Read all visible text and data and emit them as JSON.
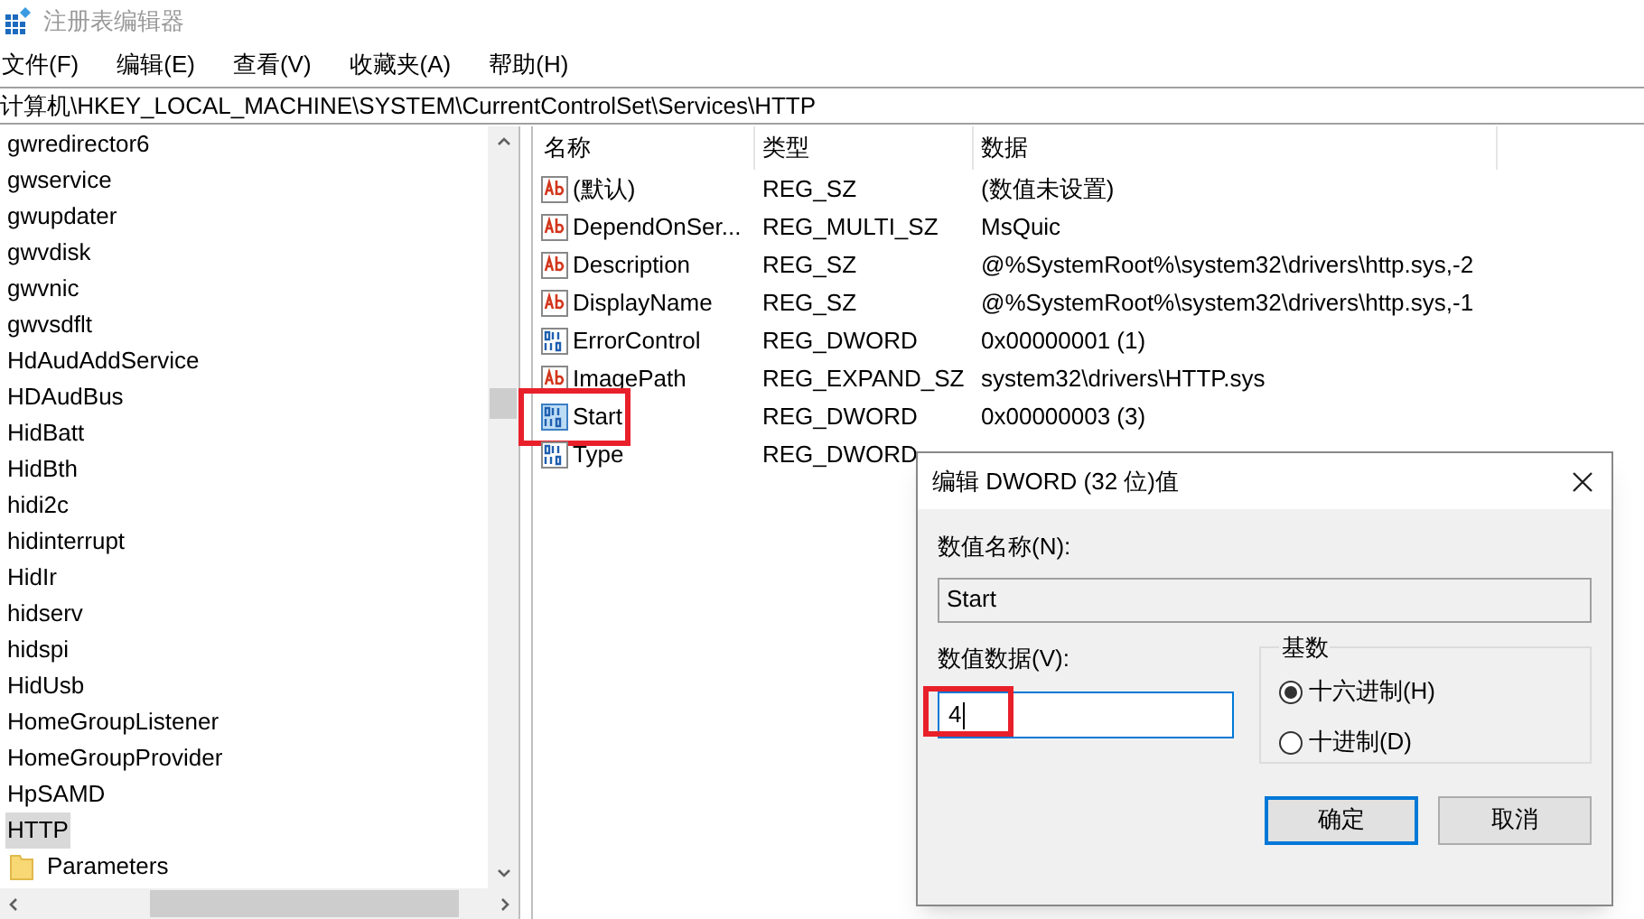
{
  "window": {
    "title": "注册表编辑器"
  },
  "menu": [
    "文件(F)",
    "编辑(E)",
    "查看(V)",
    "收藏夹(A)",
    "帮助(H)"
  ],
  "address": "计算机\\HKEY_LOCAL_MACHINE\\SYSTEM\\CurrentControlSet\\Services\\HTTP",
  "tree": [
    {
      "label": "gwredirector6",
      "selected": false
    },
    {
      "label": "gwservice",
      "selected": false
    },
    {
      "label": "gwupdater",
      "selected": false
    },
    {
      "label": "gwvdisk",
      "selected": false
    },
    {
      "label": "gwvnic",
      "selected": false
    },
    {
      "label": "gwvsdflt",
      "selected": false
    },
    {
      "label": "HdAudAddService",
      "selected": false
    },
    {
      "label": "HDAudBus",
      "selected": false
    },
    {
      "label": "HidBatt",
      "selected": false
    },
    {
      "label": "HidBth",
      "selected": false
    },
    {
      "label": "hidi2c",
      "selected": false
    },
    {
      "label": "hidinterrupt",
      "selected": false
    },
    {
      "label": "HidIr",
      "selected": false
    },
    {
      "label": "hidserv",
      "selected": false
    },
    {
      "label": "hidspi",
      "selected": false
    },
    {
      "label": "HidUsb",
      "selected": false
    },
    {
      "label": "HomeGroupListener",
      "selected": false
    },
    {
      "label": "HomeGroupProvider",
      "selected": false
    },
    {
      "label": "HpSAMD",
      "selected": false
    },
    {
      "label": "HTTP",
      "selected": true,
      "children": [
        {
          "label": "Parameters",
          "selected": false
        }
      ]
    }
  ],
  "table": {
    "columns": [
      "名称",
      "类型",
      "数据"
    ],
    "rows": [
      {
        "kind": "string",
        "name": "(默认)",
        "type": "REG_SZ",
        "data": "(数值未设置)",
        "highlighted": false
      },
      {
        "kind": "string",
        "name": "DependOnSer...",
        "type": "REG_MULTI_SZ",
        "data": "MsQuic",
        "highlighted": false
      },
      {
        "kind": "string",
        "name": "Description",
        "type": "REG_SZ",
        "data": "@%SystemRoot%\\system32\\drivers\\http.sys,-2",
        "highlighted": false
      },
      {
        "kind": "string",
        "name": "DisplayName",
        "type": "REG_SZ",
        "data": "@%SystemRoot%\\system32\\drivers\\http.sys,-1",
        "highlighted": false
      },
      {
        "kind": "binary",
        "name": "ErrorControl",
        "type": "REG_DWORD",
        "data": "0x00000001 (1)",
        "highlighted": false
      },
      {
        "kind": "string",
        "name": "ImagePath",
        "type": "REG_EXPAND_SZ",
        "data": "system32\\drivers\\HTTP.sys",
        "highlighted": false
      },
      {
        "kind": "binary",
        "name": "Start",
        "type": "REG_DWORD",
        "data": "0x00000003 (3)",
        "highlighted": true
      },
      {
        "kind": "binary",
        "name": "Type",
        "type": "REG_DWORD",
        "highlighted": false
      }
    ]
  },
  "dialog": {
    "title": "编辑 DWORD (32 位)值",
    "name_label": "数值名称(N):",
    "name_value": "Start",
    "data_label": "数值数据(V):",
    "data_value": "4",
    "data_highlighted": true,
    "base_label": "基数",
    "radios": [
      {
        "label": "十六进制(H)",
        "selected": true
      },
      {
        "label": "十进制(D)",
        "selected": false
      }
    ],
    "buttons": [
      {
        "label": "确定",
        "default": true
      },
      {
        "label": "取消",
        "default": false
      }
    ]
  }
}
